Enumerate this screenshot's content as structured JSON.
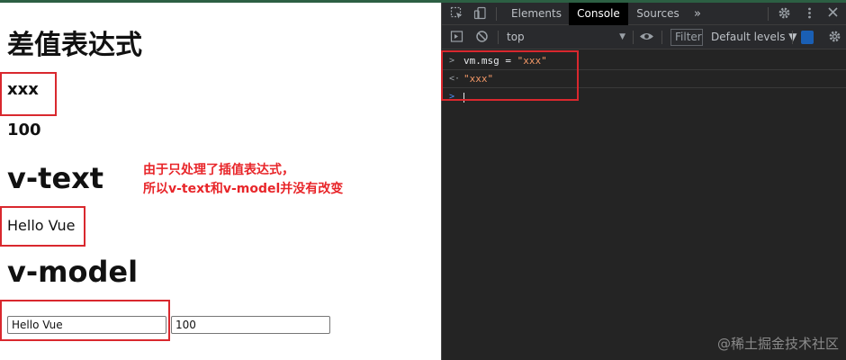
{
  "page": {
    "heading_interpolation": "差值表达式",
    "msg_value": "xxx",
    "num_value": "100",
    "heading_vtext": "v-text",
    "vtext_value": "Hello Vue",
    "annotation_line1": "由于只处理了插值表达式，",
    "annotation_line2": "所以v-text和v-model并没有改变",
    "heading_vmodel": "v-model",
    "input_msg_value": "Hello Vue",
    "input_num_value": "100"
  },
  "devtools": {
    "tabs": [
      "Elements",
      "Console",
      "Sources"
    ],
    "active_tab": "Console",
    "more_tabs_icon": "»",
    "context": "top",
    "filter_placeholder": "Filter",
    "levels_label": "Default levels ▼",
    "console": {
      "input_line": {
        "prompt": ">",
        "expr_left": "vm.msg = ",
        "expr_value": "\"xxx\""
      },
      "result_line": {
        "prompt": "<·",
        "value": "\"xxx\""
      },
      "current_prompt": ">"
    }
  },
  "watermark": "@稀土掘金技术社区",
  "colors": {
    "annotation": "#e8262a",
    "highlight_box": "#d9282e",
    "devtools_bg": "#242424",
    "string_token": "#f29766"
  }
}
